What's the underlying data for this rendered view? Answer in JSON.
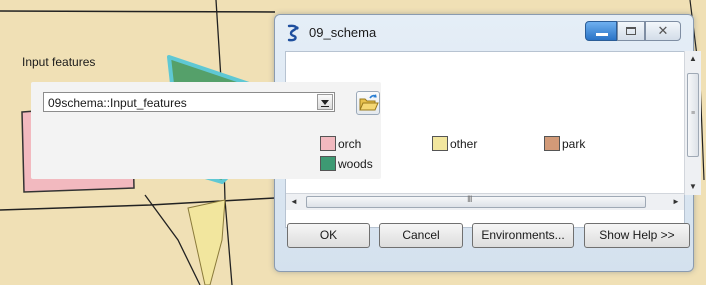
{
  "window": {
    "title": "09_schema",
    "title_icon": "tool-script-icon",
    "close_glyph": "✕"
  },
  "params": {
    "input_label": "Input features",
    "input_value": "09schema::Input_features",
    "browse_icon": "open-folder-icon"
  },
  "legend": [
    {
      "label": "orch",
      "color": "#f2b9bf"
    },
    {
      "label": "other",
      "color": "#f2e69e"
    },
    {
      "label": "park",
      "color": "#d29a78"
    },
    {
      "label": "woods",
      "color": "#3d9a73"
    }
  ],
  "scrollbars": {
    "up": "▲",
    "down": "▼",
    "left": "◄",
    "right": "►",
    "grip_h": "III",
    "grip_v": "≡"
  },
  "buttons": {
    "ok": "OK",
    "cancel": "Cancel",
    "environments": "Environments...",
    "help": "Show Help >>"
  },
  "map": {
    "background_color": "#f0e0b5",
    "orch_color": "#f2b9bf",
    "woods_color": "#55a06a",
    "other_color": "#f2e69e",
    "selection_outline_color": "#5fc8d4"
  }
}
